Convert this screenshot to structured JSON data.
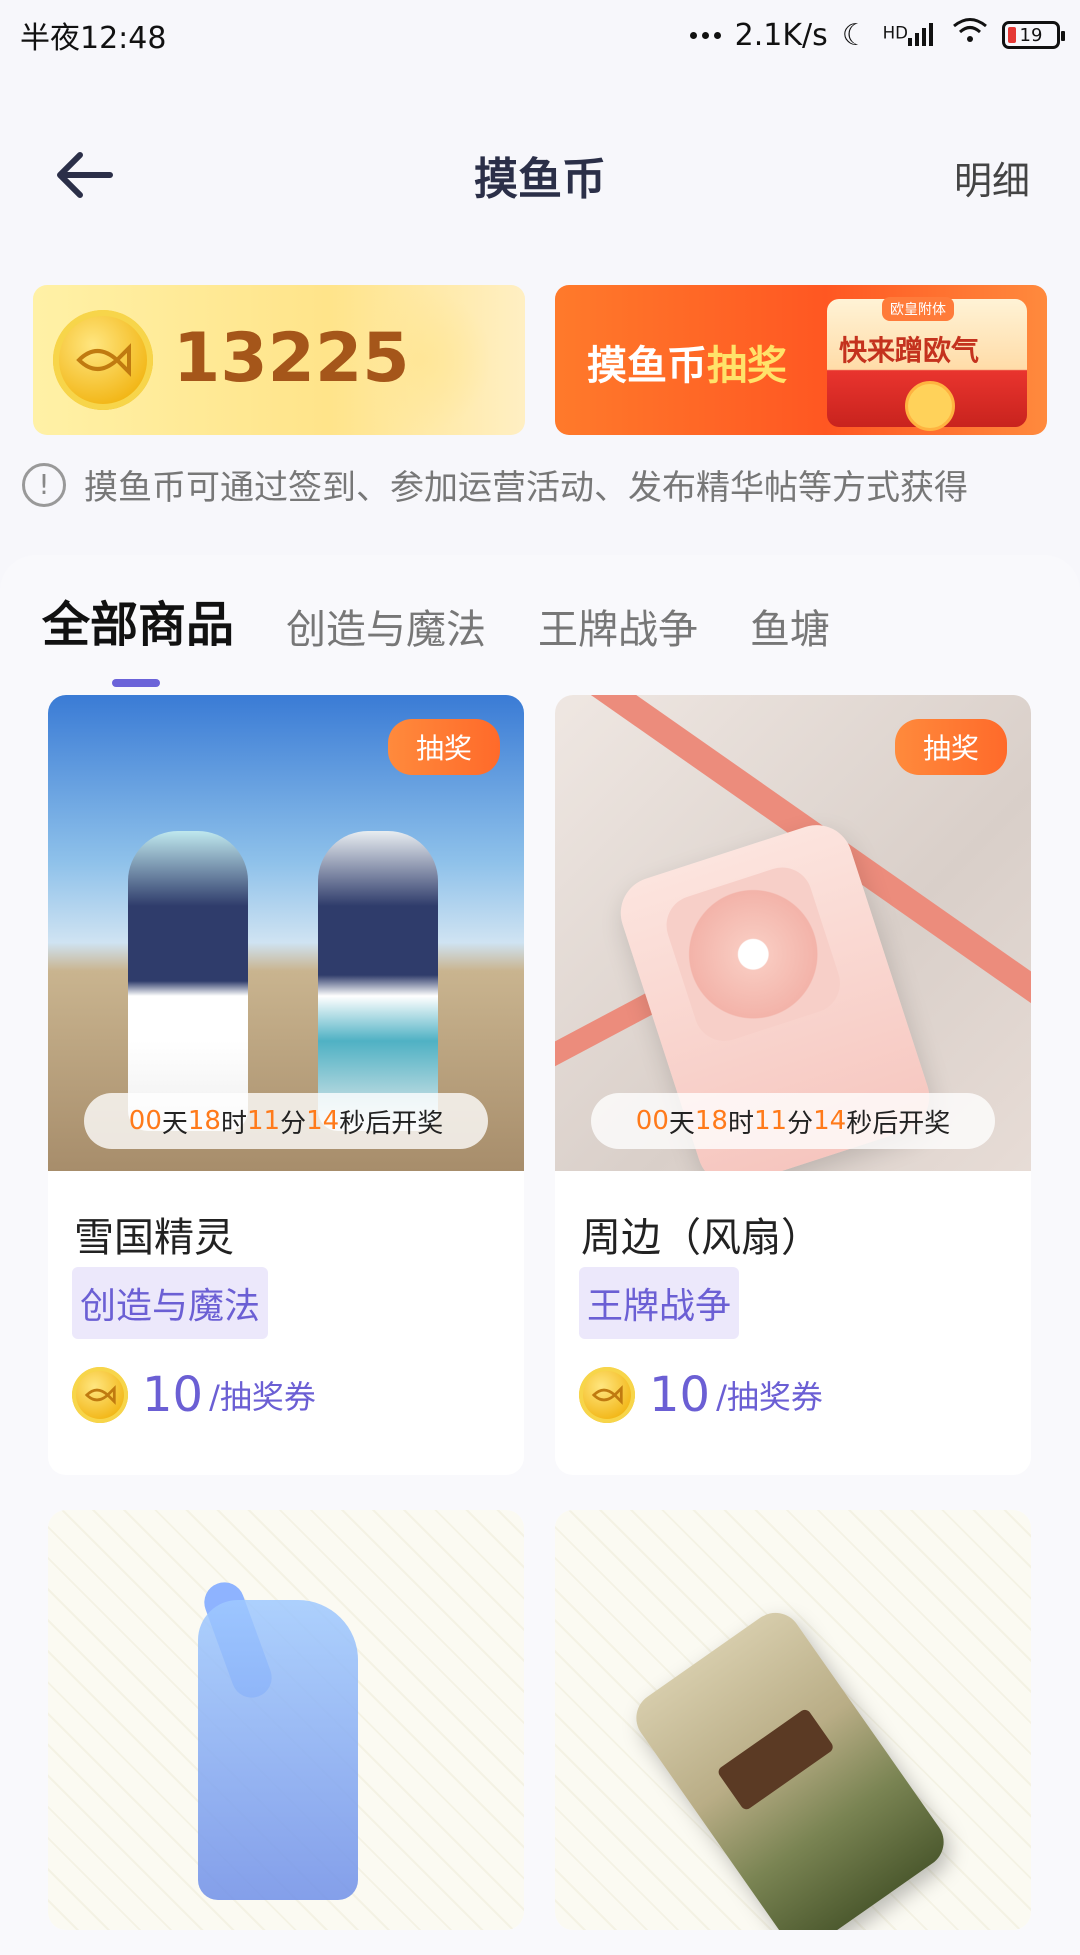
{
  "status_bar": {
    "time": "半夜12:48",
    "network_speed": "2.1K/s",
    "network_type": "HD",
    "battery": "19"
  },
  "nav": {
    "title": "摸鱼币",
    "detail": "明细"
  },
  "banner": {
    "coin_balance": "13225",
    "lottery_title_1": "摸鱼币",
    "lottery_title_2": "抽奖",
    "lottery_card_text": "快来蹭欧气",
    "lottery_card_top": "欧皇附体"
  },
  "notice": "摸鱼币可通过签到、参加运营活动、发布精华帖等方式获得",
  "tabs": [
    "全部商品",
    "创造与魔法",
    "王牌战争",
    "鱼塘"
  ],
  "products": [
    {
      "name": "雪国精灵",
      "tag": "创造与魔法",
      "badge": "抽奖",
      "countdown": {
        "d": "00",
        "d_label": "天",
        "h": "18",
        "h_label": "时",
        "m": "11",
        "m_label": "分",
        "s": "14",
        "s_label": "秒后开奖"
      },
      "price": "10",
      "unit": "/抽奖券"
    },
    {
      "name": "周边（风扇）",
      "tag": "王牌战争",
      "badge": "抽奖",
      "countdown": {
        "d": "00",
        "d_label": "天",
        "h": "18",
        "h_label": "时",
        "m": "11",
        "m_label": "分",
        "s": "14",
        "s_label": "秒后开奖"
      },
      "price": "10",
      "unit": "/抽奖券"
    }
  ],
  "colors": {
    "accent": "#6b5fd4",
    "countdown": "#ff7a1a",
    "badge": "#ff6a2a"
  }
}
